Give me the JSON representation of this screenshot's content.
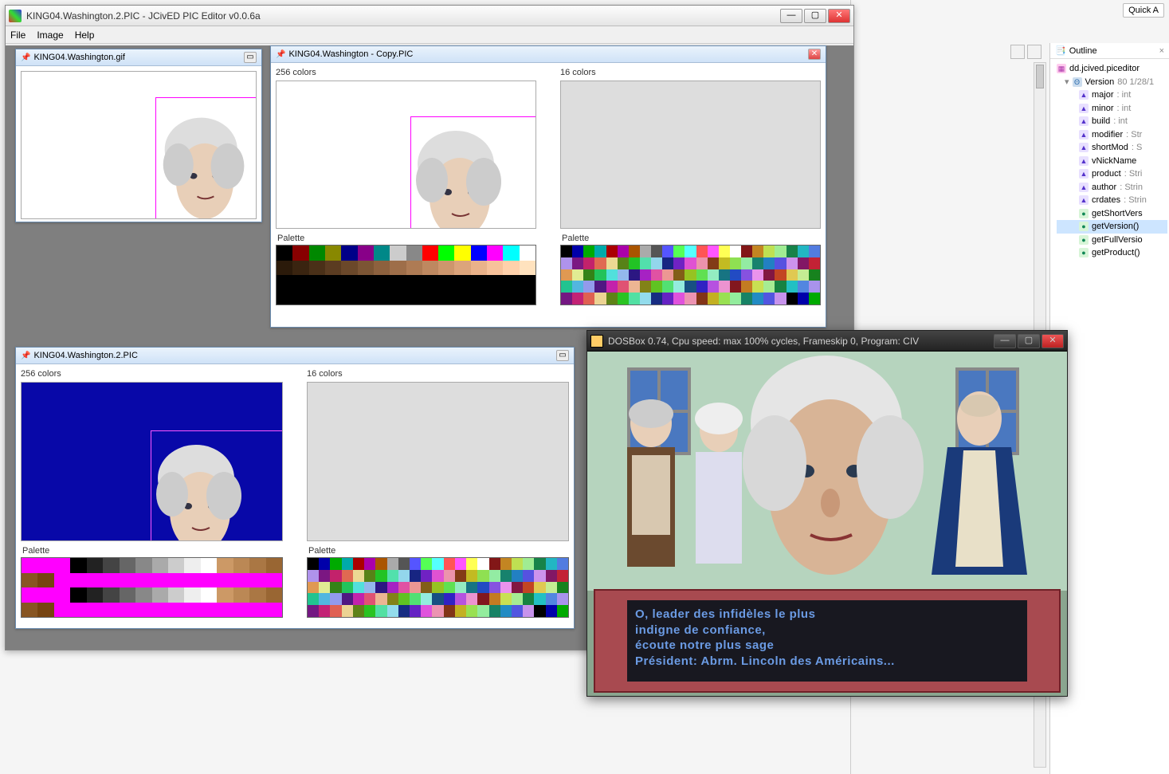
{
  "mainWindow": {
    "title": "KING04.Washington.2.PIC - JCivED PIC Editor v0.0.6a",
    "menus": [
      "File",
      "Image",
      "Help"
    ]
  },
  "subWindows": {
    "gif": {
      "title": "KING04.Washington.gif"
    },
    "copy": {
      "title": "KING04.Washington - Copy.PIC",
      "left_label": "256 colors",
      "right_label": "16 colors",
      "palette_label": "Palette"
    },
    "pic2": {
      "title": "KING04.Washington.2.PIC",
      "left_label": "256 colors",
      "right_label": "16 colors",
      "palette_label": "Palette"
    }
  },
  "outline": {
    "tab": "Outline",
    "root": "dd.jcived.piceditor",
    "version_label": "Version",
    "version_rev": "80",
    "version_date": "1/28/1",
    "items": [
      {
        "icon": "field",
        "name": "major",
        "type": "int"
      },
      {
        "icon": "field",
        "name": "minor",
        "type": "int"
      },
      {
        "icon": "field",
        "name": "build",
        "type": "int"
      },
      {
        "icon": "field",
        "name": "modifier",
        "type": "Str"
      },
      {
        "icon": "field",
        "name": "shortMod",
        "type": "S"
      },
      {
        "icon": "field",
        "name": "vNickName",
        "type": ""
      },
      {
        "icon": "field",
        "name": "product",
        "type": "Stri"
      },
      {
        "icon": "field",
        "name": "author",
        "type": "Strin"
      },
      {
        "icon": "field",
        "name": "crdates",
        "type": "Strin"
      },
      {
        "icon": "method",
        "name": "getShortVers",
        "type": ""
      },
      {
        "icon": "method",
        "name": "getVersion()",
        "type": "",
        "sel": true
      },
      {
        "icon": "method",
        "name": "getFullVersio",
        "type": ""
      },
      {
        "icon": "method",
        "name": "getProduct()",
        "type": ""
      }
    ]
  },
  "quickAccess": "Quick A",
  "dosbox": {
    "title": "DOSBox 0.74, Cpu speed: max 100% cycles, Frameskip  0, Program:      CIV",
    "text_l1": "O, leader des infidèles le plus",
    "text_l2": "indigne de confiance,",
    "text_l3": "écoute notre plus sage",
    "text_l4": "Président: Abrm. Lincoln des Américains..."
  },
  "palettes": {
    "full256": [
      "#000",
      "#800",
      "#080",
      "#880",
      "#008",
      "#808",
      "#088",
      "#ccc",
      "#888",
      "#f00",
      "#0f0",
      "#ff0",
      "#00f",
      "#f0f",
      "#0ff",
      "#fff",
      "#2b1a0a",
      "#3a2410",
      "#4a3018",
      "#5b3c21",
      "#6b482a",
      "#7c5534",
      "#8d613e",
      "#9e6e49",
      "#ae7b54",
      "#be8860",
      "#cd966d",
      "#dca47b",
      "#eab28a",
      "#f7c19a",
      "#ffd1ab",
      "#ffe2be"
    ],
    "rainbow16": [
      "#000",
      "#00a",
      "#0a0",
      "#0aa",
      "#a00",
      "#a0a",
      "#a50",
      "#aaa",
      "#555",
      "#55f",
      "#5f5",
      "#5ff",
      "#f55",
      "#f5f",
      "#ff5",
      "#fff"
    ],
    "magenta_dom": [
      "#f0f",
      "#f0f",
      "#f0f",
      "#000",
      "#222",
      "#444",
      "#666",
      "#888",
      "#aaa",
      "#ccc",
      "#eee",
      "#fff",
      "#c96",
      "#b85",
      "#a74",
      "#963",
      "#852",
      "#741",
      "#f0f",
      "#f0f",
      "#f0f",
      "#f0f",
      "#f0f",
      "#f0f",
      "#f0f",
      "#f0f",
      "#f0f",
      "#f0f",
      "#f0f",
      "#f0f",
      "#f0f",
      "#f0f"
    ]
  }
}
